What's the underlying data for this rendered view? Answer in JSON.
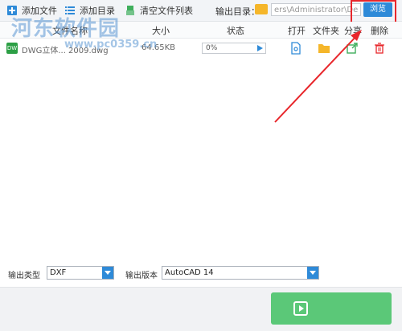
{
  "toolbar": {
    "add_file": "添加文件",
    "add_dir": "添加目录",
    "clear_list": "清空文件列表",
    "output_dir_label": "输出目录：",
    "output_path": "ers\\Administrator\\Desktop",
    "browse": "浏览"
  },
  "table": {
    "headers": {
      "name": "文件名称",
      "size": "大小",
      "status": "状态",
      "open": "打开",
      "folder": "文件夹",
      "share": "分享",
      "delete": "删除"
    },
    "rows": [
      {
        "name": "DWG立体... 2009.dwg",
        "size": "64.65KB",
        "progress": "0%",
        "progress_value": 0,
        "icon_text": "DW"
      }
    ]
  },
  "watermark": {
    "text": "河东软件园",
    "url": "www.pc0359.cn"
  },
  "bottom": {
    "output_type_label": "输出类型",
    "output_type_value": "DXF",
    "output_version_label": "输出版本",
    "output_version_value": "AutoCAD 14"
  },
  "footer": {
    "convert_label": ""
  },
  "colors": {
    "accent": "#2e8ad8",
    "convert": "#5bc878",
    "highlight": "#e8262b",
    "folder": "#f5b62a"
  }
}
